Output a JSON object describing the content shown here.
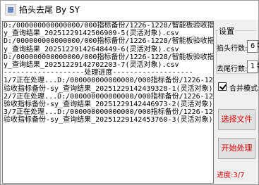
{
  "window": {
    "title": "掐头去尾 By SY"
  },
  "log": {
    "lines": [
      "D:/000000000000000/000指标备份/1226-1228/智能板验收指标备份-s",
      "y_查询结果_20251229142506909-5(灵活对象).csv",
      "D:/000000000000000/000指标备份/1226-1228/智能板验收指标备份-s",
      "y_查询结果_20251229142648449-6(灵活对象).csv",
      "D:/000000000000000/000指标备份/1226-1228/智能板验收指标备份-s",
      "y_查询结果_20251229142702203-7(灵活对象).csv",
      "",
      "-------------------处理进度-------------------",
      "1/7正在处理...D:/000000000000000/000指标备份/1226-1228/智能板",
      "验收指标备份-sy_查询结果_20251229142439328-1(灵活对象).csv",
      "2/7正在处理...D:/000000000000000/000指标备份/1226-1228/智能板",
      "验收指标备份-sy_查询结果_20251229142446973-2(灵活对象).csv",
      "3/7正在处理...D:/000000000000000/000指标备份/1226-1228/智能板",
      "验收指标备份-sy_查询结果_20251229142453760-3(灵活对象).csv"
    ]
  },
  "settings": {
    "group_label": "设置",
    "head_rows_label": "掐头行数:",
    "head_rows_value": "6",
    "tail_rows_label": "去尾行数:",
    "tail_rows_value": "1",
    "merge_mode_label": "合并模式",
    "merge_mode_checked": true
  },
  "buttons": {
    "select_file": "选择文件",
    "start": "开始处理"
  },
  "status": {
    "progress": "进度:3/7"
  },
  "colors": {
    "accent": "#e00000"
  }
}
